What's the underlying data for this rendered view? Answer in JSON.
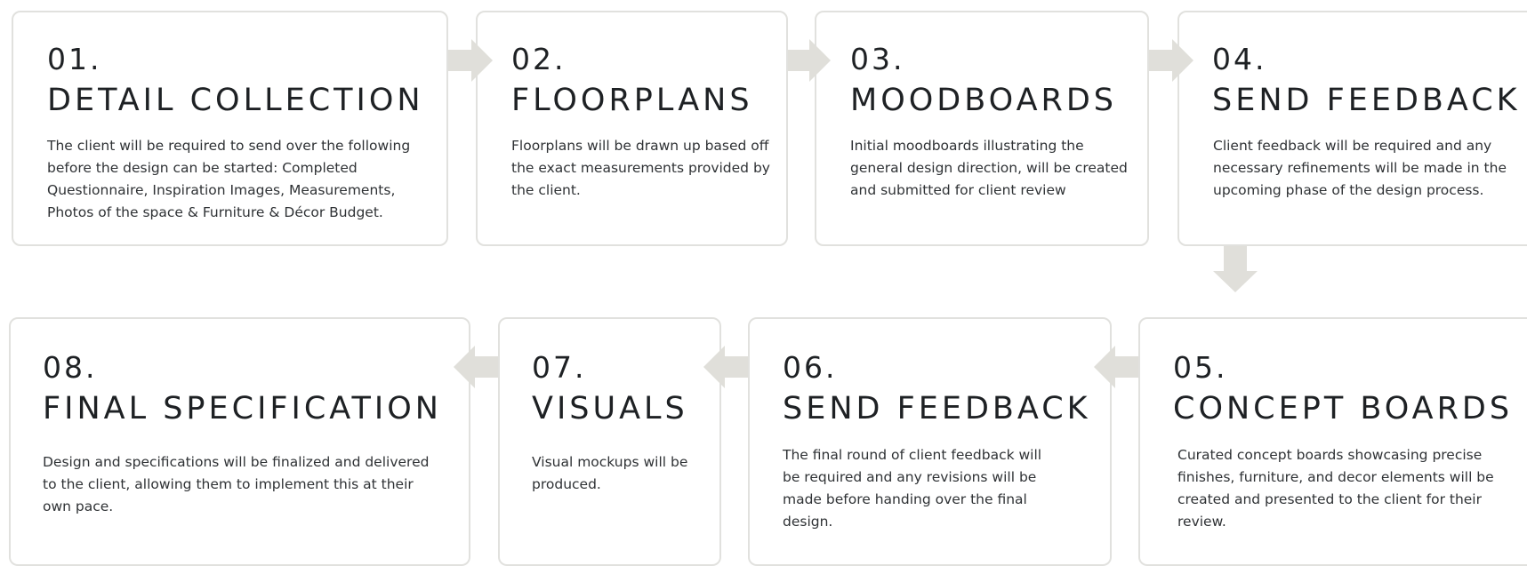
{
  "arrow_color": "#e0dfda",
  "steps": [
    {
      "num": "01.",
      "title": "DETAIL COLLECTION",
      "desc": "The client will be required to send over the following before the design can be started: Completed Questionnaire, Inspiration Images, Measurements, Photos of the space & Furniture & Décor Budget."
    },
    {
      "num": "02.",
      "title": "FLOORPLANS",
      "desc": "Floorplans will be drawn up based off the exact measurements provided by the client."
    },
    {
      "num": "03.",
      "title": "MOODBOARDS",
      "desc": "Initial moodboards illustrating the general design direction, will be created and submitted for client review"
    },
    {
      "num": "04.",
      "title": "SEND FEEDBACK",
      "desc": "Client feedback will be required and any necessary refinements will be made in the upcoming phase of the design process."
    },
    {
      "num": "05.",
      "title": "CONCEPT BOARDS",
      "desc": "Curated concept boards showcasing precise finishes, furniture, and decor elements will be created and presented to the client for their review."
    },
    {
      "num": "06.",
      "title": "SEND FEEDBACK",
      "desc": "The final round of client feedback will be required and any revisions will be made before handing over the final design."
    },
    {
      "num": "07.",
      "title": "VISUALS",
      "desc": "Visual mockups will be produced."
    },
    {
      "num": "08.",
      "title": "FINAL SPECIFICATION",
      "desc": "Design and specifications will be finalized and delivered to the client, allowing them to implement this at their own pace."
    }
  ]
}
